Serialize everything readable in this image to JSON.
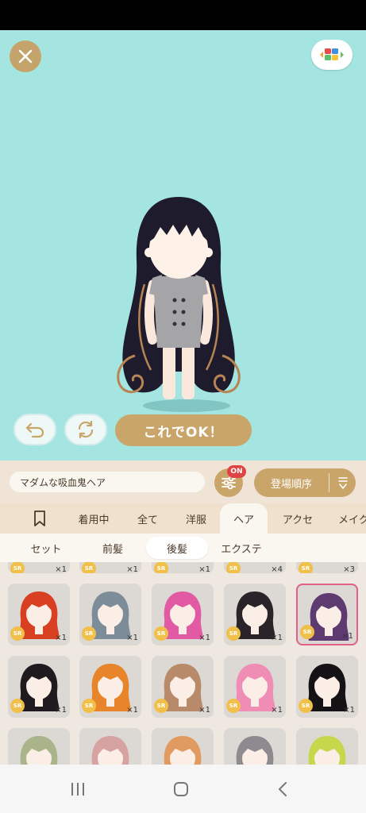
{
  "stage": {
    "ok_label": "これでOK！",
    "background_color": "#a4e5e2"
  },
  "item_name": "マダムな吸血鬼ヘア",
  "filter_badge": "ON",
  "sort_label": "登場順序",
  "category_tabs": [
    "着用中",
    "全て",
    "洋服",
    "ヘア",
    "アクセ",
    "メイク"
  ],
  "active_category": "ヘア",
  "sub_tabs": [
    "セット",
    "前髪",
    "後髪",
    "エクステ"
  ],
  "active_sub_tab": "後髪",
  "rarity_label": "SR",
  "items_partial_row": [
    {
      "count": "×1"
    },
    {
      "count": "×1"
    },
    {
      "count": "×1"
    },
    {
      "count": "×4"
    },
    {
      "count": "×3"
    }
  ],
  "items_row1": [
    {
      "icon": "red-flame-hair-icon",
      "hair": "#d94022",
      "count": "×1"
    },
    {
      "icon": "gray-bun-hair-icon",
      "hair": "#7c8d99",
      "count": "×1"
    },
    {
      "icon": "pink-spiky-hair-icon",
      "hair": "#e25aa3",
      "count": "×1"
    },
    {
      "icon": "black-twintail-hair-icon",
      "hair": "#2a2327",
      "count": "×1"
    },
    {
      "icon": "purple-wavy-hair-icon",
      "hair": "#5d3a70",
      "count": "×1",
      "selected": true
    }
  ],
  "items_row2": [
    {
      "icon": "black-pigtail-hair-icon",
      "hair": "#1e1a1f",
      "count": "×1"
    },
    {
      "icon": "orange-pigtail-hair-icon",
      "hair": "#e8852a",
      "count": "×1"
    },
    {
      "icon": "brown-bun-hair-icon",
      "hair": "#b98a6a",
      "count": "×1"
    },
    {
      "icon": "pink-long-hair-icon",
      "hair": "#ef8db5",
      "count": "×1"
    },
    {
      "icon": "black-straight-hair-icon",
      "hair": "#141214",
      "count": "×1"
    }
  ],
  "items_row3": [
    {
      "icon": "green-fairy-hair-icon",
      "hair": "#aab48a"
    },
    {
      "icon": "pink-bob-hair-icon",
      "hair": "#d7a2a2"
    },
    {
      "icon": "orange-curl-hair-icon",
      "hair": "#e19a5f"
    },
    {
      "icon": "gray-short-hair-icon",
      "hair": "#8d8a90"
    },
    {
      "icon": "lime-long-hair-icon",
      "hair": "#c7d74b"
    }
  ]
}
